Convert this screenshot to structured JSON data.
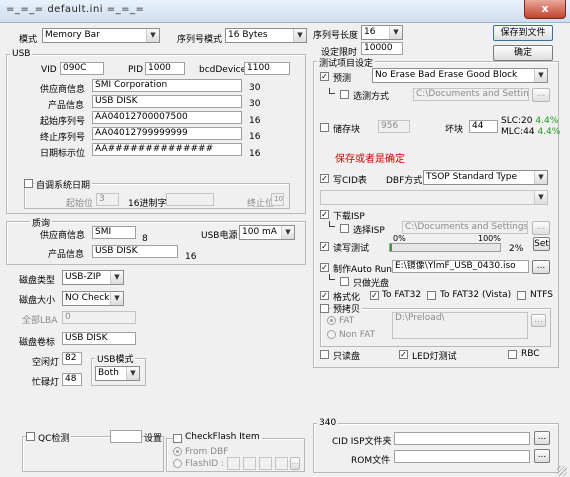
{
  "window": {
    "title": "=_=_=   default.ini   =_=_=",
    "close": "x"
  },
  "top": {
    "mode_label": "模式",
    "mode_value": "Memory Bar",
    "sn_mode_label": "序列号模式",
    "sn_mode_value": "16 Bytes",
    "sn_len_label": "序列号长度",
    "sn_len_value": "16",
    "limit_label": "设定限时",
    "limit_value": "10000",
    "save_file_btn": "保存到文件",
    "ok_btn": "确定"
  },
  "usb": {
    "group": "USB",
    "vid_label": "VID",
    "vid": "090C",
    "pid_label": "PID",
    "pid": "1000",
    "bcd_label": "bcdDevice",
    "bcd": "1100",
    "vendor_label": "供应商信息",
    "vendor": "SMI Corporation",
    "vendor_len": "30",
    "product_label": "产品信息",
    "product": "USB DISK",
    "product_len": "30",
    "start_sn_label": "起始序列号",
    "start_sn": "AA04012700007500",
    "start_sn_len": "16",
    "end_sn_label": "终止序列号",
    "end_sn": "AA04012799999999",
    "end_sn_len": "16",
    "date_label": "日期标示位",
    "date": "AA##############",
    "date_len": "16",
    "auto_date_label": "自调系统日期",
    "start_bit_label": "起始位",
    "start_bit": "3",
    "hex_label": "16进制字",
    "end_bit_label": "终止位",
    "end_bit": "10"
  },
  "quality": {
    "group": "质询",
    "vendor_label": "供应商信息",
    "vendor": "SMI",
    "vendor_len": "8",
    "power_label": "USB电源",
    "power": "100 mA",
    "product_label": "产品信息",
    "product": "USB DISK",
    "product_len": "16"
  },
  "disk": {
    "type_label": "磁盘类型",
    "type": "USB-ZIP",
    "size_label": "磁盘大小",
    "size": "NO Check",
    "lba_label": "全部LBA",
    "lba": "0",
    "vol_label": "磁盘卷标",
    "vol": "USB DISK",
    "idle_led_label": "空闲灯",
    "idle_led": "82",
    "busy_led_label": "忙碌灯",
    "busy_led": "48",
    "usb_mode_label": "USB模式",
    "usb_mode": "Both"
  },
  "qc": {
    "label": "QC检测",
    "setup": "设置"
  },
  "checkflash": {
    "label": "CheckFlash Item",
    "from_dbf": "From DBF",
    "flash_id": "FlashID :"
  },
  "test": {
    "group": "测试项目设定",
    "pretest_label": "预测",
    "pretest_value": "No Erase Bad Erase Good Block",
    "select_mode_label": "选测方式",
    "select_mode_path": "C:\\Documents and Settings\\pit",
    "storage_label": "储存块",
    "storage_value": "956",
    "bad_label": "坏块",
    "bad_value": "44",
    "slc_text": "SLC:20",
    "slc_pct": "4.4%",
    "mlc_text": "MLC:44",
    "mlc_pct": "4.4%",
    "note": "保存或者是确定",
    "write_cid_label": "写CID表",
    "dbf_label": "DBF方式",
    "dbf_value": "TSOP Standard Type",
    "download_isp_label": "下载ISP",
    "select_isp_label": "选择ISP",
    "isp_path": "C:\\Documents and Settings\\pitt.cl",
    "rw_test_label": "读写测试",
    "rw_min": "0%",
    "rw_max": "100%",
    "rw_value": "2%",
    "set_btn": "Set",
    "rw_progress": 0.02,
    "autorun_label": "制作Auto Run",
    "autorun_path": "E:\\镜像\\YlmF_USB_0430.iso",
    "cdrom_label": "只做光盘",
    "format_label": "格式化",
    "fat32": "To FAT32",
    "fat32_vista": "To FAT32 (Vista)",
    "ntfs": "NTFS",
    "precopy_label": "预拷贝",
    "fat_label": "FAT",
    "fat_path": "D:\\Preload\\",
    "nonfat_label": "Non FAT",
    "readonly_label": "只读盘",
    "led_test_label": "LED灯测试",
    "rbc_label": "RBC",
    "browse": "..."
  },
  "g340": {
    "group": "340",
    "cid_isp_label": "CID ISP文件夹",
    "rom_label": "ROM文件",
    "browse": "..."
  }
}
